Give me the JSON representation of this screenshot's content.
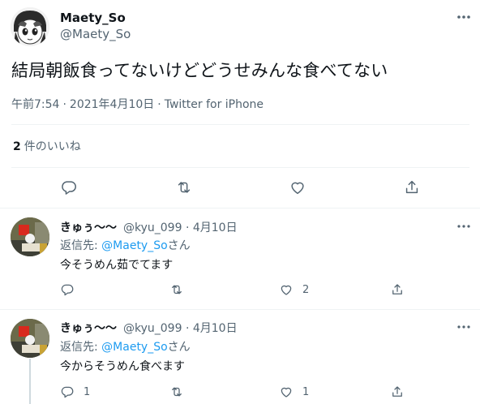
{
  "main_tweet": {
    "author_name": "Maety_So",
    "author_handle": "@Maety_So",
    "text": "結局朝飯食ってないけどどうせみんな食べてない",
    "time": "午前7:54",
    "date": "2021年4月10日",
    "separator": "·",
    "source": "Twitter for iPhone",
    "likes_count": "2",
    "likes_label": "件のいいね"
  },
  "replies": [
    {
      "author_name": "きゅぅ〜〜",
      "author_handle": "@kyu_099",
      "separator": "·",
      "date": "4月10日",
      "reply_to_label": "返信先: ",
      "reply_to_handle": "@Maety_So",
      "reply_to_suffix": "さん",
      "text": "今そうめん茹でてます",
      "reply_count": "",
      "retweet_count": "",
      "like_count": "2"
    },
    {
      "author_name": "きゅぅ〜〜",
      "author_handle": "@kyu_099",
      "separator": "·",
      "date": "4月10日",
      "reply_to_label": "返信先: ",
      "reply_to_handle": "@Maety_So",
      "reply_to_suffix": "さん",
      "text": "今からそうめん食べます",
      "reply_count": "1",
      "retweet_count": "",
      "like_count": "1"
    }
  ],
  "icons": {
    "more": "more-dots-icon",
    "reply": "reply-bubble-icon",
    "retweet": "retweet-icon",
    "like": "heart-icon",
    "share": "share-icon"
  },
  "colors": {
    "text": "#0f1419",
    "secondary": "#536471",
    "link": "#1d9bf0",
    "divider": "#eff3f4"
  }
}
